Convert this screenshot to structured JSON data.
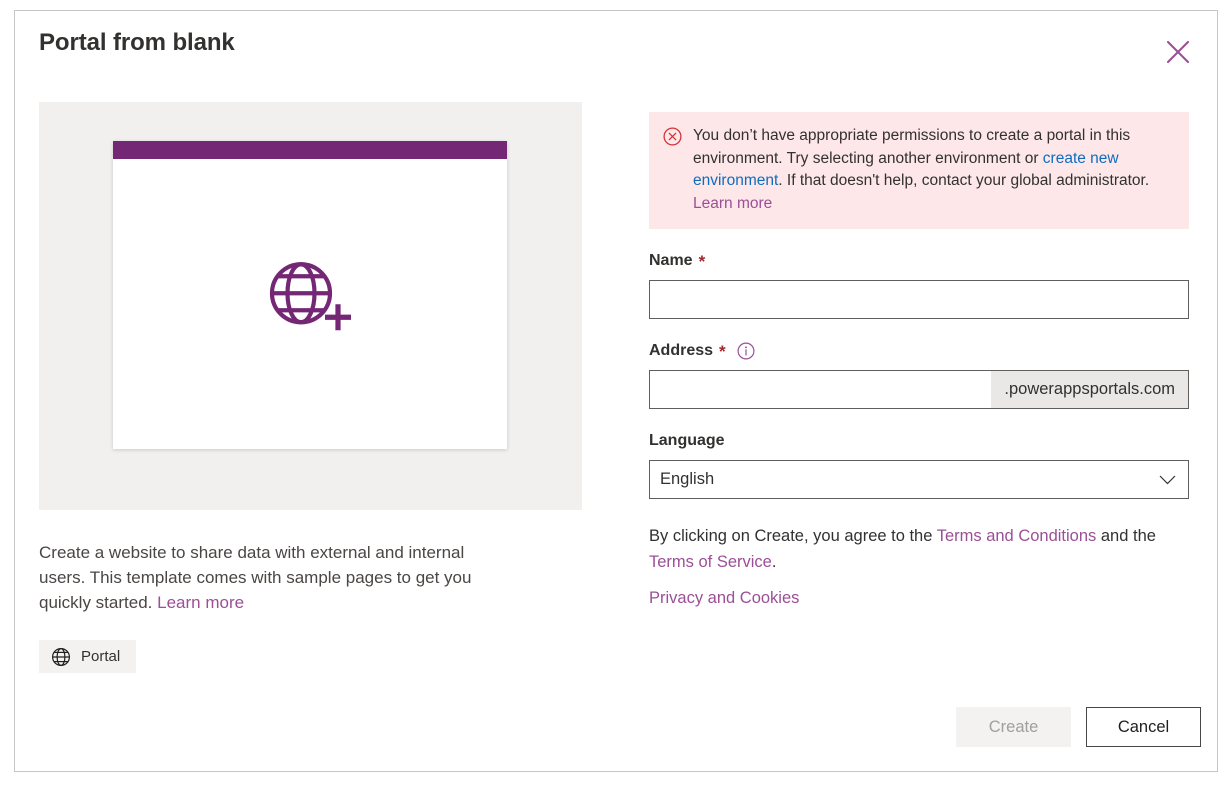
{
  "dialog": {
    "title": "Portal from blank",
    "close_icon": "close-icon",
    "close_label": "Close"
  },
  "preview": {
    "icon": "globe-plus-icon",
    "topbar_color": "#742774",
    "panel_color": "#f1f0ef"
  },
  "description": {
    "text": "Create a website to share data with external and internal users. This template comes with sample pages to get you quickly started.",
    "learn_more": "Learn more"
  },
  "tag": {
    "icon": "globe-icon",
    "label": "Portal"
  },
  "error": {
    "icon": "error-circle-x-icon",
    "part1": "You don’t have appropriate permissions to create a portal in this environment. Try selecting another environment or ",
    "link_create": "create new environment",
    "part2": ". If that doesn't help, contact your global administrator. ",
    "learn_more": "Learn more",
    "background": "#fde7e9",
    "icon_color": "#d13438"
  },
  "fields": {
    "name": {
      "label": "Name",
      "required_mark": "*",
      "value": "",
      "placeholder": ""
    },
    "address": {
      "label": "Address",
      "required_mark": "*",
      "info_icon": "info-circle-icon",
      "value": "",
      "placeholder": "",
      "suffix": ".powerappsportals.com"
    },
    "language": {
      "label": "Language",
      "selected": "English",
      "chevron_icon": "chevron-down-icon"
    }
  },
  "terms": {
    "prefix": "By clicking on Create, you agree to the ",
    "terms_and_conditions": "Terms and Conditions",
    "middle": " and the ",
    "terms_of_service": "Terms of Service",
    "suffix": ".",
    "privacy_and_cookies": "Privacy and Cookies"
  },
  "footer": {
    "create_label": "Create",
    "cancel_label": "Cancel"
  },
  "colors": {
    "accent_purple": "#9b4f96",
    "brand_purple": "#742774",
    "link_blue": "#0f6cbd",
    "error_red": "#a4262c"
  }
}
